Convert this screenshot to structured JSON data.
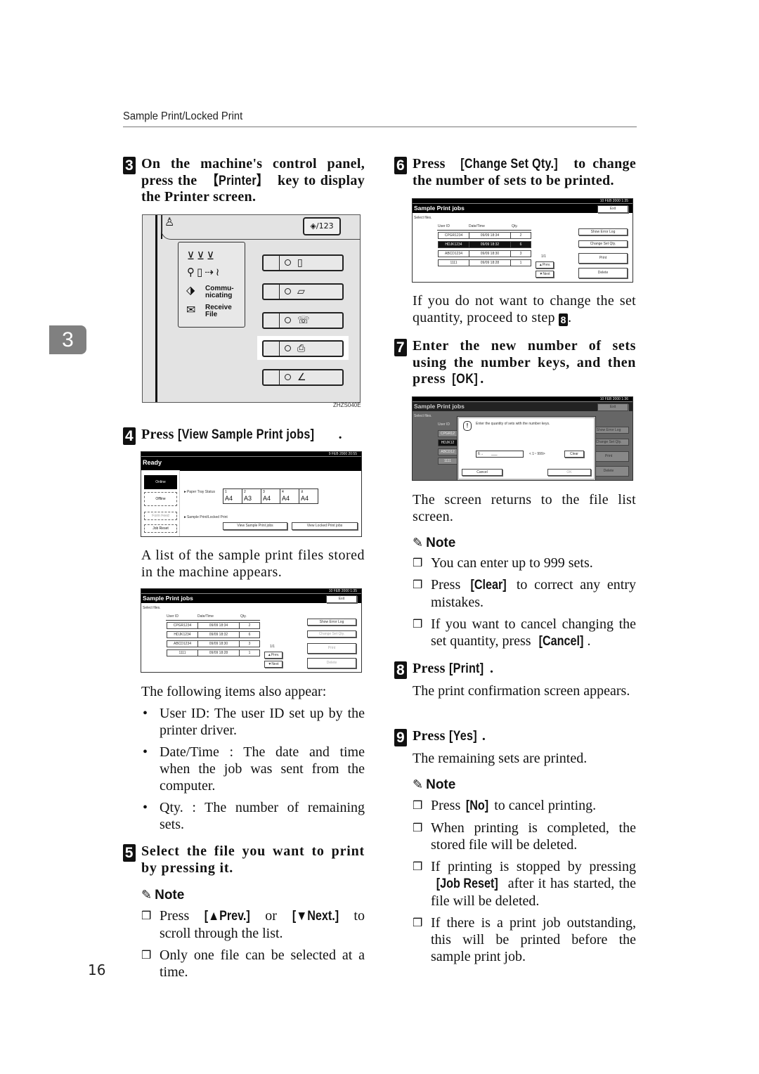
{
  "page": {
    "running_header": "Sample Print/Locked Print",
    "chapter_tab": "3",
    "page_number": "16",
    "figure_code": "ZHZS040E"
  },
  "steps": {
    "s3": {
      "num": "3",
      "pre": "On the machine's control panel, press the ",
      "key": "【Printer】",
      "post": " key to display the Printer screen."
    },
    "s4": {
      "num": "4",
      "pre": "Press ",
      "key": "[View Sample Print jobs]",
      "post": "."
    },
    "s4_after": "A list of the sample print files stored in the machine appears.",
    "s4_after2": "The following items also appear:",
    "s4_bullets": [
      "User ID: The user ID set up by the printer driver.",
      "Date/Time : The date and time when the job was sent from the computer.",
      "Qty. : The number of remaining sets."
    ],
    "s5": {
      "num": "5",
      "text": "Select the file you want to print by pressing it."
    },
    "s5_note": {
      "title": "Note",
      "items": [
        {
          "pre": "Press ",
          "key1": "[▲Prev.]",
          "mid": " or ",
          "key2": "[▼Next.]",
          "post": " to scroll through the list."
        },
        {
          "text": "Only one file can be selected at a time."
        }
      ]
    },
    "s6": {
      "num": "6",
      "pre": "Press ",
      "key": "[Change Set Qty.]",
      "post": " to change the number of sets to be printed."
    },
    "s6_after": {
      "pre": "If you do not want to change the set quantity, proceed to step ",
      "ref": "8",
      "post": "."
    },
    "s7": {
      "num": "7",
      "pre": "Enter the new number of sets using the number keys, and then press ",
      "key": "[OK]",
      "post": "."
    },
    "s7_after": "The screen returns to the file list screen.",
    "s7_note": {
      "title": "Note",
      "items": [
        {
          "pre": "You can enter up to 999 sets.",
          "key": "",
          "post": ""
        },
        {
          "pre": "Press ",
          "key": "[Clear]",
          "post": " to correct any entry mistakes."
        },
        {
          "pre": "If you want to cancel changing the set quantity, press ",
          "key": "[Cancel]",
          "post": "."
        }
      ]
    },
    "s8": {
      "num": "8",
      "pre": "Press ",
      "key": "[Print]",
      "post": "."
    },
    "s8_after": "The print confirmation screen appears.",
    "s9": {
      "num": "9",
      "pre": "Press ",
      "key": "[Yes]",
      "post": "."
    },
    "s9_after": "The remaining sets are printed.",
    "s9_note": {
      "title": "Note",
      "items": [
        {
          "pre": "Press ",
          "key": "[No]",
          "post": " to cancel printing."
        },
        {
          "pre": "When printing is completed, the stored file will be deleted.",
          "key": "",
          "post": ""
        },
        {
          "pre": "If printing is stopped by pressing ",
          "key": "[Job Reset]",
          "post": " after it has started, the file will be deleted."
        },
        {
          "pre": "If there is a print job outstanding, this will be printed before the sample print job.",
          "key": "",
          "post": ""
        }
      ]
    }
  },
  "control_panel": {
    "lang_key": "◈/123",
    "indicators": {
      "row1_icons": "🖶🖶🖶",
      "communicating": "Commu-\nnicating",
      "receive_file": "Receive\nFile"
    },
    "mode_keys": [
      {
        "name": "copy",
        "icon": "▯"
      },
      {
        "name": "document-server",
        "icon": "▱"
      },
      {
        "name": "facsimile",
        "icon": "☏"
      },
      {
        "name": "printer",
        "icon": "⎙",
        "highlighted": true
      },
      {
        "name": "scanner",
        "icon": "∠"
      }
    ]
  },
  "ready_screen": {
    "datetime": "9 FEB 2000 20:55",
    "title": "Ready",
    "side_buttons": [
      "Online",
      "Offline",
      "Form Feed",
      "Job Reset"
    ],
    "paper_tray_label": "►Paper Tray Status",
    "trays": [
      {
        "tag": "1",
        "size": "A4"
      },
      {
        "tag": "2",
        "size": "A3"
      },
      {
        "tag": "3",
        "size": "A4"
      },
      {
        "tag": "4",
        "size": "A4"
      },
      {
        "tag": "bypass",
        "size": "A4"
      }
    ],
    "sample_locked_label": "►Sample Print/Locked Print",
    "view_sample_btn": "View Sample Print jobs",
    "view_locked_btn": "View Locked Print jobs"
  },
  "jobs_screen_a": {
    "datetime": "10 FEB 2000 1:35",
    "title": "Sample Print jobs",
    "exit": "Exit",
    "select_files": "Select files.",
    "columns": [
      "User ID",
      "Date/Time",
      "Qty."
    ],
    "rows": [
      {
        "user": "CPGR1234",
        "date": "09/09 18:34",
        "qty": "2",
        "selected": false
      },
      {
        "user": "HDJK1234",
        "date": "09/09 18:32",
        "qty": "6",
        "selected": false
      },
      {
        "user": "ABCD1234",
        "date": "09/09 18:30",
        "qty": "3",
        "selected": false
      },
      {
        "user": "1111",
        "date": "09/09 18:28",
        "qty": "1",
        "selected": false
      }
    ],
    "page_indicator": "1/1",
    "prev": "▲Prev.",
    "next": "▼Next",
    "buttons": [
      "Show Error Log",
      "Change Set Qty.",
      "Print",
      "Delete"
    ]
  },
  "jobs_screen_b": {
    "datetime": "10 FEB 2000 1:35",
    "title": "Sample Print jobs",
    "exit": "Exit",
    "select_files": "Select files.",
    "columns": [
      "User ID",
      "Date/Time",
      "Qty."
    ],
    "rows": [
      {
        "user": "CPGR1234",
        "date": "09/09 18:34",
        "qty": "2"
      },
      {
        "user": "HDJK1234",
        "date": "09/09 18:32",
        "qty": "6"
      },
      {
        "user": "ABCD1234",
        "date": "09/09 18:30",
        "qty": "3"
      },
      {
        "user": "1111",
        "date": "09/09 18:28",
        "qty": "1"
      }
    ],
    "page_indicator": "1/1",
    "prev": "▲Prev.",
    "next": "▼Next",
    "buttons": [
      "Show Error Log",
      "Change Set Qty.",
      "Print",
      "Delete"
    ]
  },
  "jobs_screen_c": {
    "datetime": "10 FEB 2000 1:36",
    "title": "Sample Print jobs",
    "exit": "Exit",
    "select_files": "Select files.",
    "user_col": "User ID",
    "partial_users": [
      "CPGR12",
      "HDJK12",
      "ABCD12",
      "1111"
    ],
    "side_buttons": [
      "Show Error Log",
      "Change Set Qty.",
      "Print",
      "Delete"
    ],
    "dialog": {
      "message": "Enter the quantity of sets with the number keys.",
      "input_prefix": "6→",
      "input_value": "___",
      "range": "< 1~ 999>",
      "clear": "Clear",
      "cancel": "Cancel",
      "ok": "OK"
    }
  }
}
